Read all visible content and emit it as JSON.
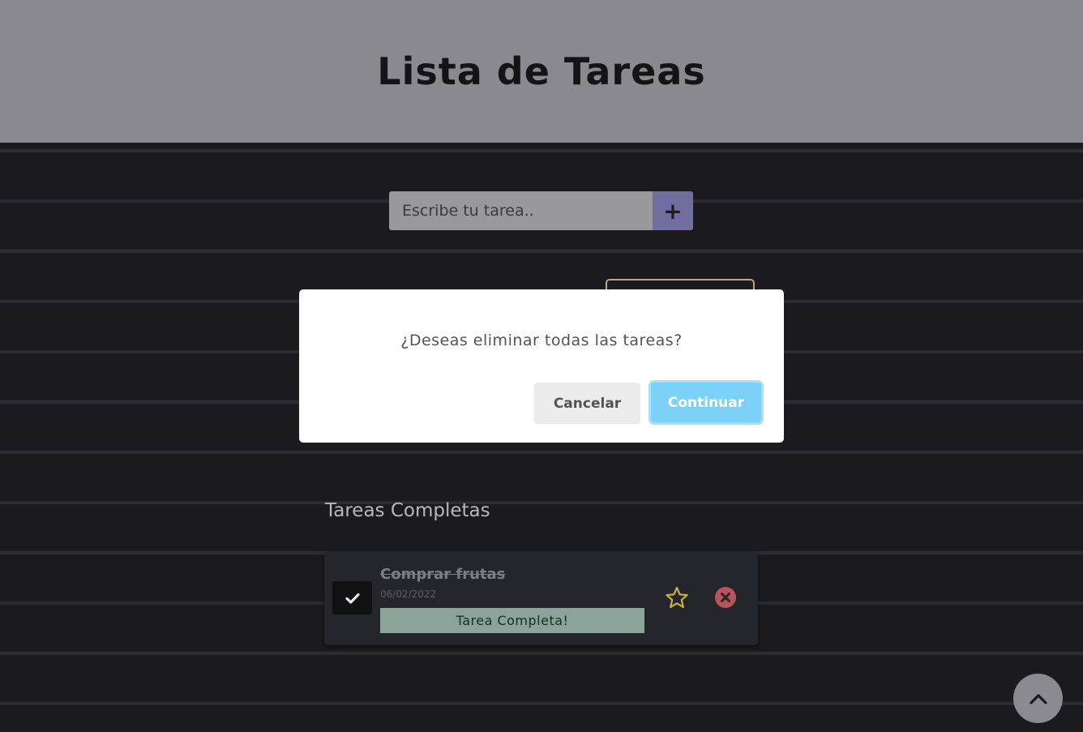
{
  "header": {
    "title": "Lista de Tareas"
  },
  "add_form": {
    "placeholder": "Escribe tu tarea..",
    "add_label": "+"
  },
  "completed_section": {
    "title": "Tareas Completas",
    "tasks": [
      {
        "name": "Comprar frutas",
        "date": "06/02/2022",
        "status": "Tarea Completa!",
        "completed": true
      }
    ]
  },
  "dialog": {
    "message": "¿Deseas eliminar todas las tareas?",
    "cancel_label": "Cancelar",
    "continue_label": "Continuar"
  },
  "icons": {
    "check": "check-icon",
    "star": "star-outline-icon",
    "delete": "close-circle-icon",
    "scroll_top": "chevron-up-icon"
  },
  "colors": {
    "header_bg": "#8a8990",
    "add_button": "#6f6e9e",
    "completed_badge": "#8aa49a",
    "star": "#c9b04a",
    "delete": "#b8555c",
    "continue_button": "#7cd1f9"
  }
}
